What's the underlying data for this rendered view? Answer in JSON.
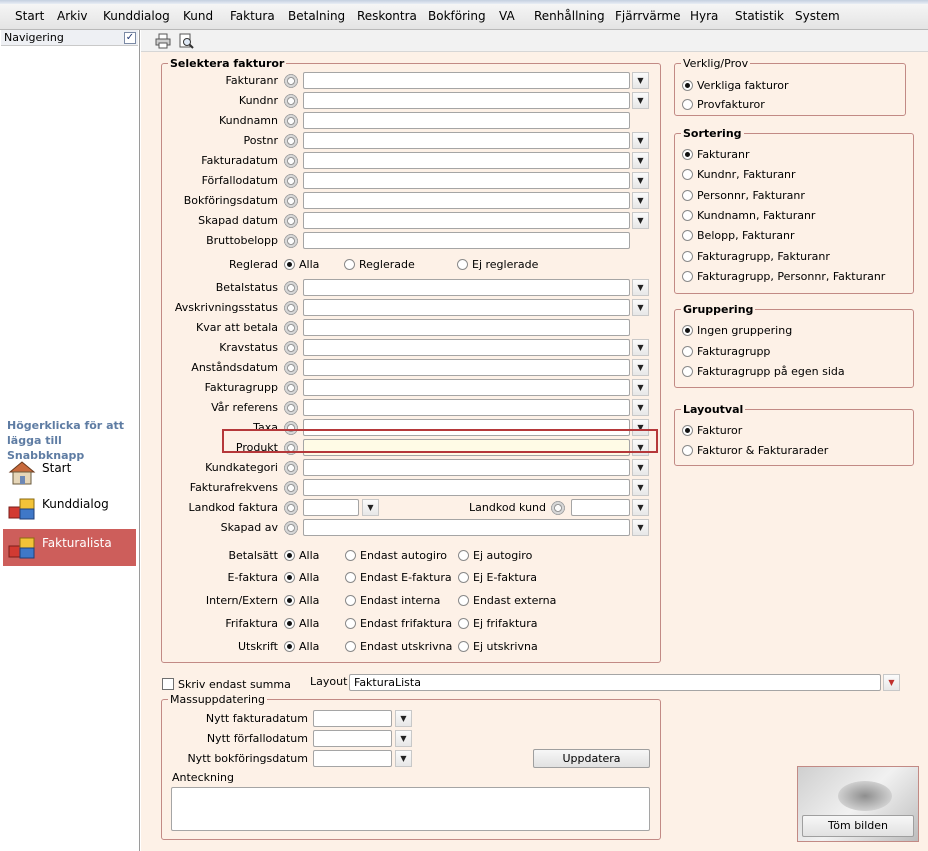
{
  "menu": [
    "Start",
    "Arkiv",
    "Kunddialog",
    "Kund",
    "Faktura",
    "Betalning",
    "Reskontra",
    "Bokföring",
    "VA",
    "Renhållning",
    "Fjärrvärme",
    "Hyra",
    "Statistik",
    "System"
  ],
  "nav": {
    "title": "Navigering",
    "checked_mark": "✓",
    "hint": "Högerklicka för att lägga till Snabbknapp",
    "buttons": [
      {
        "label": "Start",
        "icon": "house-icon"
      },
      {
        "label": "Kunddialog",
        "icon": "grid-icon"
      },
      {
        "label": "Fakturalista",
        "icon": "grid-icon",
        "active": true
      }
    ]
  },
  "toolbar": {
    "icons": [
      "print-icon",
      "preview-icon"
    ]
  },
  "select": {
    "title": "Selektera fakturor",
    "fields": [
      {
        "label": "Fakturanr",
        "dropdown": true
      },
      {
        "label": "Kundnr",
        "dropdown": true
      },
      {
        "label": "Kundnamn",
        "dropdown": false
      },
      {
        "label": "Postnr",
        "dropdown": true
      },
      {
        "label": "Fakturadatum",
        "dropdown": true
      },
      {
        "label": "Förfallodatum",
        "dropdown": true
      },
      {
        "label": "Bokföringsdatum",
        "dropdown": true
      },
      {
        "label": "Skapad datum",
        "dropdown": true
      },
      {
        "label": "Bruttobelopp",
        "dropdown": false
      }
    ],
    "reglerad": {
      "label": "Reglerad",
      "options": [
        "Alla",
        "Reglerade",
        "Ej reglerade"
      ],
      "selected": 0
    },
    "fields2": [
      {
        "label": "Betalstatus",
        "dropdown": true
      },
      {
        "label": "Avskrivningsstatus",
        "dropdown": true
      },
      {
        "label": "Kvar att betala",
        "dropdown": false
      },
      {
        "label": "Kravstatus",
        "dropdown": true
      },
      {
        "label": "Anståndsdatum",
        "dropdown": true
      },
      {
        "label": "Fakturagrupp",
        "dropdown": true
      },
      {
        "label": "Vår referens",
        "dropdown": true
      },
      {
        "label": "Taxa",
        "dropdown": true
      },
      {
        "label": "Produkt",
        "dropdown": true,
        "focused": true
      },
      {
        "label": "Kundkategori",
        "dropdown": true
      },
      {
        "label": "Fakturafrekvens",
        "dropdown": true
      }
    ],
    "landkod_faktura": "Landkod faktura",
    "landkod_kund": "Landkod kund",
    "skapad_av": "Skapad av",
    "radio_rows": [
      {
        "label": "Betalsätt",
        "options": [
          "Alla",
          "Endast autogiro",
          "Ej autogiro"
        ],
        "selected": 0
      },
      {
        "label": "E-faktura",
        "options": [
          "Alla",
          "Endast E-faktura",
          "Ej E-faktura"
        ],
        "selected": 0
      },
      {
        "label": "Intern/Extern",
        "options": [
          "Alla",
          "Endast interna",
          "Endast externa"
        ],
        "selected": 0
      },
      {
        "label": "Frifaktura",
        "options": [
          "Alla",
          "Endast frifaktura",
          "Ej frifaktura"
        ],
        "selected": 0
      },
      {
        "label": "Utskrift",
        "options": [
          "Alla",
          "Endast utskrivna",
          "Ej utskrivna"
        ],
        "selected": 0
      }
    ]
  },
  "verklig": {
    "title": "Verklig/Prov",
    "options": [
      "Verkliga fakturor",
      "Provfakturor"
    ],
    "selected": 0
  },
  "sortering": {
    "title": "Sortering",
    "options": [
      "Fakturanr",
      "Kundnr, Fakturanr",
      "Personnr, Fakturanr",
      "Kundnamn, Fakturanr",
      "Belopp, Fakturanr",
      "Fakturagrupp, Fakturanr",
      "Fakturagrupp, Personnr, Fakturanr"
    ],
    "selected": 0
  },
  "gruppering": {
    "title": "Gruppering",
    "options": [
      "Ingen gruppering",
      "Fakturagrupp",
      "Fakturagrupp på egen sida"
    ],
    "selected": 0
  },
  "layoutval": {
    "title": "Layoutval",
    "options": [
      "Fakturor",
      "Fakturor & Fakturarader"
    ],
    "selected": 0
  },
  "bottom": {
    "skriv_summa": "Skriv endast summa",
    "layout_label": "Layout",
    "layout_value": "FakturaLista"
  },
  "mass": {
    "title": "Massuppdatering",
    "fields": [
      "Nytt fakturadatum",
      "Nytt förfallodatum",
      "Nytt bokföringsdatum"
    ],
    "update_button": "Uppdatera",
    "note_label": "Anteckning"
  },
  "image_panel": {
    "clear_button": "Töm bilden"
  },
  "colors": {
    "accent": "#cd5e5b",
    "panel_bg": "#fdf1e7",
    "focus_border": "#b5383a",
    "focus_bg": "#fffbe6"
  }
}
